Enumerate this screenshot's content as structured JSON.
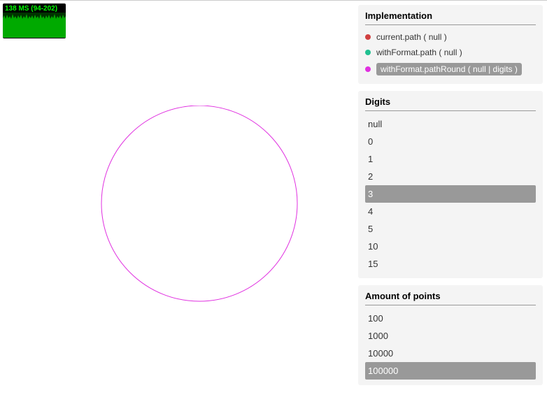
{
  "perf": {
    "label": "138 MS (94-202)"
  },
  "circle": {
    "stroke": "#e030e0"
  },
  "panels": {
    "implementation": {
      "title": "Implementation",
      "items": [
        {
          "color": "#d04040",
          "label": "current.path ( null )",
          "selected": false
        },
        {
          "color": "#20c090",
          "label": "withFormat.path ( null )",
          "selected": false
        },
        {
          "color": "#e030e0",
          "label": "withFormat.pathRound ( null | digits )",
          "selected": true
        }
      ]
    },
    "digits": {
      "title": "Digits",
      "items": [
        {
          "label": "null",
          "selected": false
        },
        {
          "label": "0",
          "selected": false
        },
        {
          "label": "1",
          "selected": false
        },
        {
          "label": "2",
          "selected": false
        },
        {
          "label": "3",
          "selected": true
        },
        {
          "label": "4",
          "selected": false
        },
        {
          "label": "5",
          "selected": false
        },
        {
          "label": "10",
          "selected": false
        },
        {
          "label": "15",
          "selected": false
        }
      ]
    },
    "points": {
      "title": "Amount of points",
      "items": [
        {
          "label": "100",
          "selected": false
        },
        {
          "label": "1000",
          "selected": false
        },
        {
          "label": "10000",
          "selected": false
        },
        {
          "label": "100000",
          "selected": true
        }
      ]
    }
  }
}
